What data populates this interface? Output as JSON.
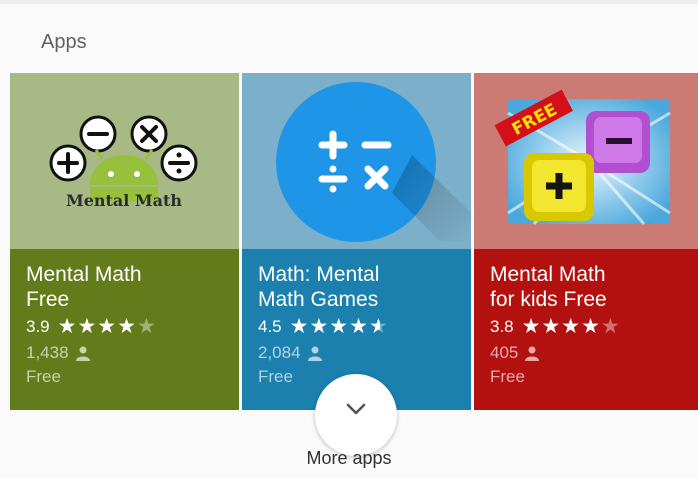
{
  "section": {
    "title": "Apps"
  },
  "apps": [
    {
      "name_line1": "Mental Math",
      "name_line2": "Free",
      "rating": "3.9",
      "stars": 4,
      "installs": "1,438",
      "price": "Free",
      "art_text": "Mental Math",
      "colors": {
        "art": "#a9b986",
        "info": "#647b1b"
      }
    },
    {
      "name_line1": "Math: Mental",
      "name_line2": "Math Games",
      "rating": "4.5",
      "stars": 4.5,
      "installs": "2,084",
      "price": "Free",
      "colors": {
        "art": "#7cafc9",
        "info": "#1b80ad"
      }
    },
    {
      "name_line1": "Mental Math",
      "name_line2": "for kids Free",
      "rating": "3.8",
      "stars": 4,
      "installs": "405",
      "price": "Free",
      "art_text": "FREE",
      "colors": {
        "art": "#cc7a74",
        "info": "#b3110f"
      }
    }
  ],
  "more": {
    "label": "More apps",
    "icon": "chevron-down-icon"
  }
}
